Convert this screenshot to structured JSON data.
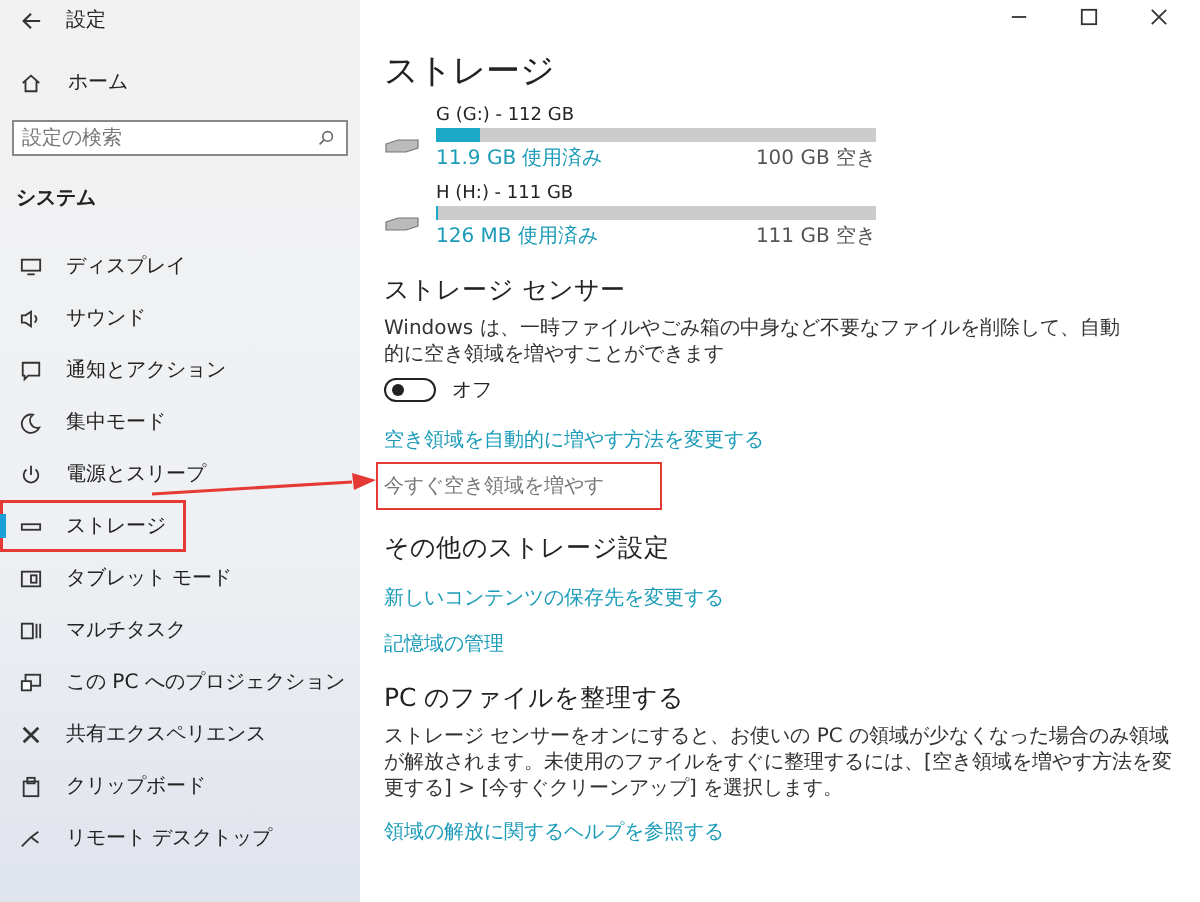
{
  "window": {
    "title": "設定"
  },
  "sidebar": {
    "home": "ホーム",
    "search": {
      "placeholder": "設定の検索"
    },
    "section": "システム",
    "items": [
      {
        "label": "ディスプレイ",
        "selected": false,
        "outlined": false
      },
      {
        "label": "サウンド",
        "selected": false,
        "outlined": false
      },
      {
        "label": "通知とアクション",
        "selected": false,
        "outlined": false
      },
      {
        "label": "集中モード",
        "selected": false,
        "outlined": false
      },
      {
        "label": "電源とスリープ",
        "selected": false,
        "outlined": false
      },
      {
        "label": "ストレージ",
        "selected": true,
        "outlined": true
      },
      {
        "label": "タブレット モード",
        "selected": false,
        "outlined": false
      },
      {
        "label": "マルチタスク",
        "selected": false,
        "outlined": false
      },
      {
        "label": "この PC へのプロジェクション",
        "selected": false,
        "outlined": false
      },
      {
        "label": "共有エクスペリエンス",
        "selected": false,
        "outlined": false
      },
      {
        "label": "クリップボード",
        "selected": false,
        "outlined": false
      },
      {
        "label": "リモート デスクトップ",
        "selected": false,
        "outlined": false
      }
    ]
  },
  "page": {
    "title": "ストレージ",
    "drives": [
      {
        "label": "G (G:) - 112 GB",
        "level": 0.1,
        "used": "11.9 GB 使用済み",
        "free": "100 GB 空き"
      },
      {
        "label": "H (H:) - 111 GB",
        "level": 0.001,
        "used": "126 MB 使用済み",
        "free": "111 GB 空き"
      }
    ],
    "sensor": {
      "heading": "ストレージ センサー",
      "description": "Windows は、一時ファイルやごみ箱の中身など不要なファイルを削除して、自動的に空き領域を増やすことができます",
      "toggle": {
        "on": false,
        "label": "オフ"
      },
      "links": [
        {
          "text": "空き領域を自動的に増やす方法を変更する",
          "disabled": false,
          "outlined": false
        },
        {
          "text": "今すぐ空き領域を増やす",
          "disabled": true,
          "outlined": true
        }
      ]
    },
    "other": {
      "heading": "その他のストレージ設定",
      "links": [
        "新しいコンテンツの保存先を変更する",
        "記憶域の管理"
      ]
    },
    "organize": {
      "heading": "PC のファイルを整理する",
      "description": "ストレージ センサーをオンにすると、お使いの PC の領域が少なくなった場合のみ領域が解放されます。未使用のファイルをすぐに整理するには、[空き領域を増やす方法を変更する] > [今すぐクリーンアップ] を選択します。",
      "link": "領域の解放に関するヘルプを参照する"
    }
  }
}
